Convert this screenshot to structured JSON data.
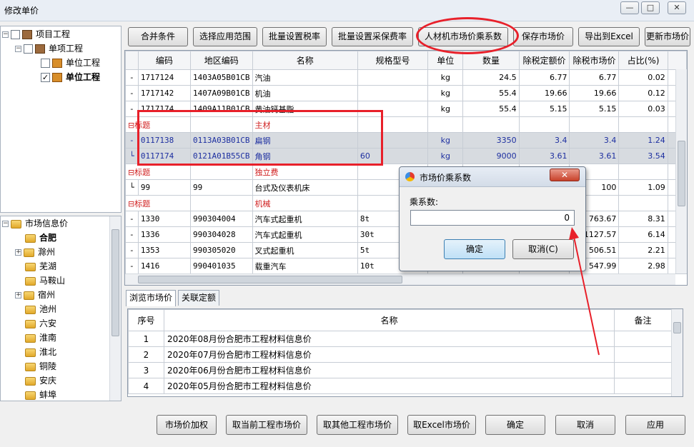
{
  "window": {
    "title": "修改单价",
    "min_icon": "minimize-icon",
    "max_icon": "restore-icon",
    "close_icon": "close-icon",
    "min_glyph": "—",
    "max_glyph": "□",
    "close_glyph": "✕"
  },
  "project_tree": [
    {
      "label": "项目工程",
      "checked": false,
      "icon": "project-icon"
    },
    {
      "label": "单项工程",
      "checked": false,
      "icon": "building-icon"
    },
    {
      "label": "单位工程",
      "checked": false,
      "icon": "book-icon"
    },
    {
      "label": "单位工程",
      "checked": true,
      "icon": "book-icon"
    }
  ],
  "info_tree": {
    "root": "市场信息价",
    "items": [
      "合肥",
      "滁州",
      "芜湖",
      "马鞍山",
      "宿州",
      "池州",
      "六安",
      "淮南",
      "淮北",
      "铜陵",
      "安庆",
      "蚌埠"
    ]
  },
  "toolbar": {
    "merge": "合并条件",
    "apply_scope": "选择应用范围",
    "batch_tax": "批量设置税率",
    "batch_purchase": "批量设置采保费率",
    "labor_coef": "人材机市场价乘系数",
    "save_price": "保存市场价",
    "export_excel": "导出到Excel",
    "update_price": "更新市场价"
  },
  "grid": {
    "headers": [
      "编码",
      "地区编码",
      "名称",
      "规格型号",
      "单位",
      "数量",
      "除税定额价",
      "除税市场价",
      "占比(%)"
    ],
    "rows": [
      {
        "code": "1717124",
        "region": "1403A05B01CB",
        "name": "汽油",
        "spec": "",
        "unit": "kg",
        "qty": "24.5",
        "fixed": "6.77",
        "market": "6.77",
        "ratio": "0.02"
      },
      {
        "code": "1717142",
        "region": "1407A09B01CB",
        "name": "机油",
        "spec": "",
        "unit": "kg",
        "qty": "55.4",
        "fixed": "19.66",
        "market": "19.66",
        "ratio": "0.12"
      },
      {
        "code": "1717174",
        "region": "1409A11B01CB",
        "name": "黄油钙基脂",
        "spec": "",
        "unit": "kg",
        "qty": "55.4",
        "fixed": "5.15",
        "market": "5.15",
        "ratio": "0.03"
      },
      {
        "title": "标题",
        "group": "主材"
      },
      {
        "code": "0117138",
        "region": "0113A03B01CB",
        "name": "扁钢",
        "spec": "",
        "unit": "kg",
        "qty": "3350",
        "fixed": "3.4",
        "market": "3.4",
        "ratio": "1.24",
        "selected": true
      },
      {
        "code": "0117174",
        "region": "0121A01B55CB",
        "name": "角钢",
        "spec": "60",
        "unit": "kg",
        "qty": "9000",
        "fixed": "3.61",
        "market": "3.61",
        "ratio": "3.54",
        "selected": true
      },
      {
        "title": "标题",
        "group": "独立费"
      },
      {
        "code": "99",
        "region": "99",
        "name": "台式及仪表机床",
        "spec": "",
        "unit": "",
        "qty": "",
        "fixed": "",
        "market": "100",
        "ratio": "1.09"
      },
      {
        "title": "标题",
        "group": "机械"
      },
      {
        "code": "1330",
        "region": "990304004",
        "name": "汽车式起重机",
        "spec": "8t",
        "unit": "",
        "qty": "",
        "fixed": "",
        "market": "763.67",
        "ratio": "8.31"
      },
      {
        "code": "1336",
        "region": "990304028",
        "name": "汽车式起重机",
        "spec": "30t",
        "unit": "",
        "qty": "",
        "fixed": "",
        "market": "1127.57",
        "ratio": "6.14"
      },
      {
        "code": "1353",
        "region": "990305020",
        "name": "叉式起重机",
        "spec": "5t",
        "unit": "",
        "qty": "",
        "fixed": "",
        "market": "506.51",
        "ratio": "2.21"
      },
      {
        "code": "1416",
        "region": "990401035",
        "name": "载重汽车",
        "spec": "10t",
        "unit": "",
        "qty": "",
        "fixed": "",
        "market": "547.99",
        "ratio": "2.98"
      }
    ]
  },
  "tabs": [
    "浏览市场价",
    "关联定额"
  ],
  "market_list": {
    "headers": [
      "序号",
      "名称",
      "备注"
    ],
    "rows": [
      {
        "no": "1",
        "name": "2020年08月份合肥市工程材料信息价"
      },
      {
        "no": "2",
        "name": "2020年07月份合肥市工程材料信息价"
      },
      {
        "no": "3",
        "name": "2020年06月份合肥市工程材料信息价"
      },
      {
        "no": "4",
        "name": "2020年05月份合肥市工程材料信息价"
      }
    ]
  },
  "bottom_buttons": {
    "weighted": "市场价加权",
    "current": "取当前工程市场价",
    "other": "取其他工程市场价",
    "excel": "取Excel市场价",
    "ok": "确定",
    "cancel": "取消",
    "apply": "应用"
  },
  "dialog": {
    "title": "市场价乘系数",
    "label": "乘系数:",
    "value": "0",
    "ok": "确定",
    "cancel": "取消(C)",
    "close_glyph": "✕"
  },
  "colors": {
    "annotation": "#e8202a",
    "title_red": "#d02020",
    "selected_blue": "#1d2fa0"
  }
}
